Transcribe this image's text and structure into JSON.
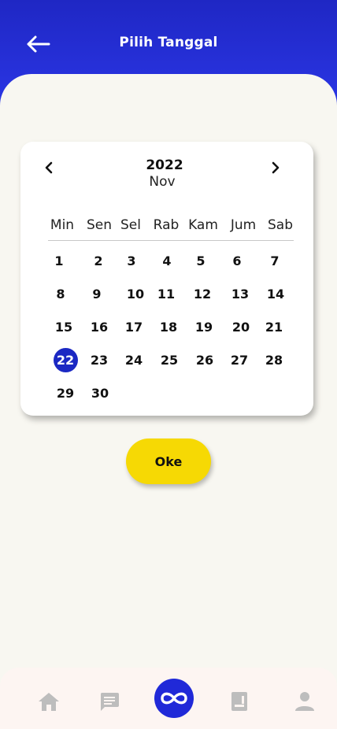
{
  "header": {
    "title": "Pilih Tanggal",
    "back_icon": "arrow-left-icon"
  },
  "calendar": {
    "year": "2022",
    "month": "Nov",
    "prev_icon": "chevron-left-icon",
    "next_icon": "chevron-right-icon",
    "weekdays": [
      "Min",
      "Sen",
      "Sel",
      "Rab",
      "Kam",
      "Jum",
      "Sab"
    ],
    "weeks": [
      [
        "1",
        "2",
        "3",
        "4",
        "5",
        "6",
        "7"
      ],
      [
        "8",
        "9",
        "10",
        "11",
        "12",
        "13",
        "14"
      ],
      [
        "15",
        "16",
        "17",
        "18",
        "19",
        "20",
        "21"
      ],
      [
        "22",
        "23",
        "24",
        "25",
        "26",
        "27",
        "28"
      ],
      [
        "29",
        "30"
      ]
    ],
    "selected": "22",
    "selected_color": "#1b28c3"
  },
  "actions": {
    "ok_label": "Oke",
    "ok_color": "#f6d904"
  },
  "bottom_nav": {
    "items": [
      "home-icon",
      "chat-icon",
      "infinity-icon",
      "document-icon",
      "person-icon"
    ],
    "active_color": "#2029d8"
  }
}
